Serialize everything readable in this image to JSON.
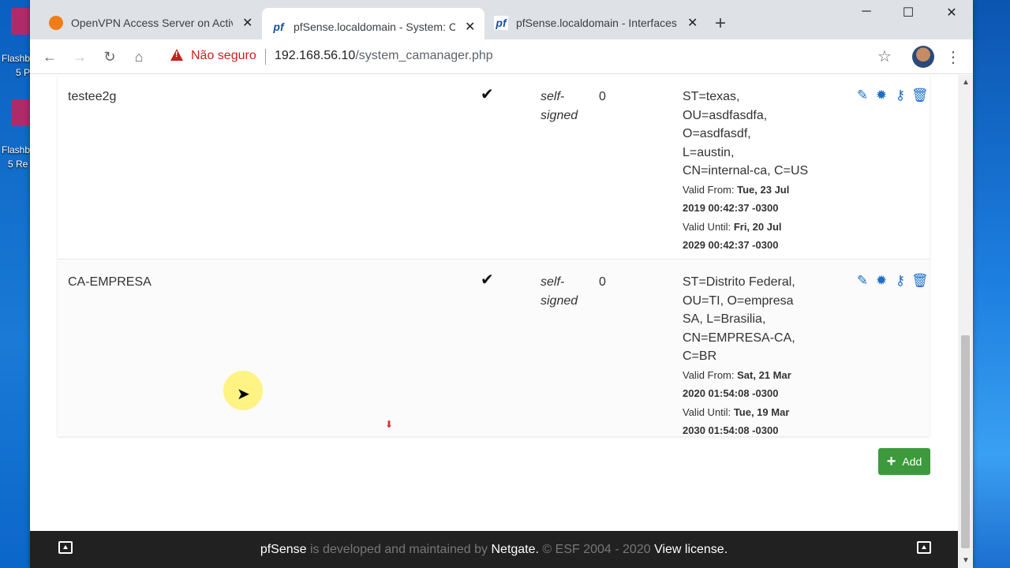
{
  "desktop": {
    "icon1_label_a": "Flashb",
    "icon1_label_b": "5 P",
    "icon2_label_a": "Flashb",
    "icon2_label_b": "5 Re"
  },
  "browser": {
    "tabs": [
      {
        "title": "OpenVPN Access Server on Activ",
        "icon": "openvpn-icon",
        "active": false
      },
      {
        "title": "pfSense.localdomain - System: C",
        "icon": "pfsense-icon",
        "active": true
      },
      {
        "title": "pfSense.localdomain - Interfaces",
        "icon": "pfsense-icon",
        "active": false
      }
    ],
    "security_label": "Não seguro",
    "url_host": "192.168.56.10",
    "url_path": "/system_camanager.php"
  },
  "table": {
    "rows": [
      {
        "name": "testee2g",
        "internal": "✔",
        "issuer_a": "self-",
        "issuer_b": "signed",
        "certs": "0",
        "dn": [
          "ST=texas,",
          "OU=asdfasdfa,",
          "O=asdfasdf,",
          "L=austin,",
          "CN=internal-ca, C=US"
        ],
        "valid_from_label": "Valid From:",
        "valid_from_a": "Tue, 23 Jul",
        "valid_from_b": "2019 00:42:37 -0300",
        "valid_until_label": "Valid Until:",
        "valid_until_a": "Fri, 20 Jul",
        "valid_until_b": "2029 00:42:37 -0300"
      },
      {
        "name": "CA-EMPRESA",
        "internal": "✔",
        "issuer_a": "self-",
        "issuer_b": "signed",
        "certs": "0",
        "dn": [
          "ST=Distrito Federal,",
          "OU=TI, O=empresa",
          "SA, L=Brasilia,",
          "CN=EMPRESA-CA,",
          "C=BR"
        ],
        "valid_from_label": "Valid From:",
        "valid_from_a": "Sat, 21 Mar",
        "valid_from_b": "2020 01:54:08 -0300",
        "valid_until_label": "Valid Until:",
        "valid_until_a": "Tue, 19 Mar",
        "valid_until_b": "2030 01:54:08 -0300"
      }
    ]
  },
  "add_button": "Add",
  "footer": {
    "brand": "pfSense",
    "middle": " is developed and maintained by ",
    "company": "Netgate.",
    "copyright": " © ESF 2004 - 2020 ",
    "license": "View license."
  }
}
